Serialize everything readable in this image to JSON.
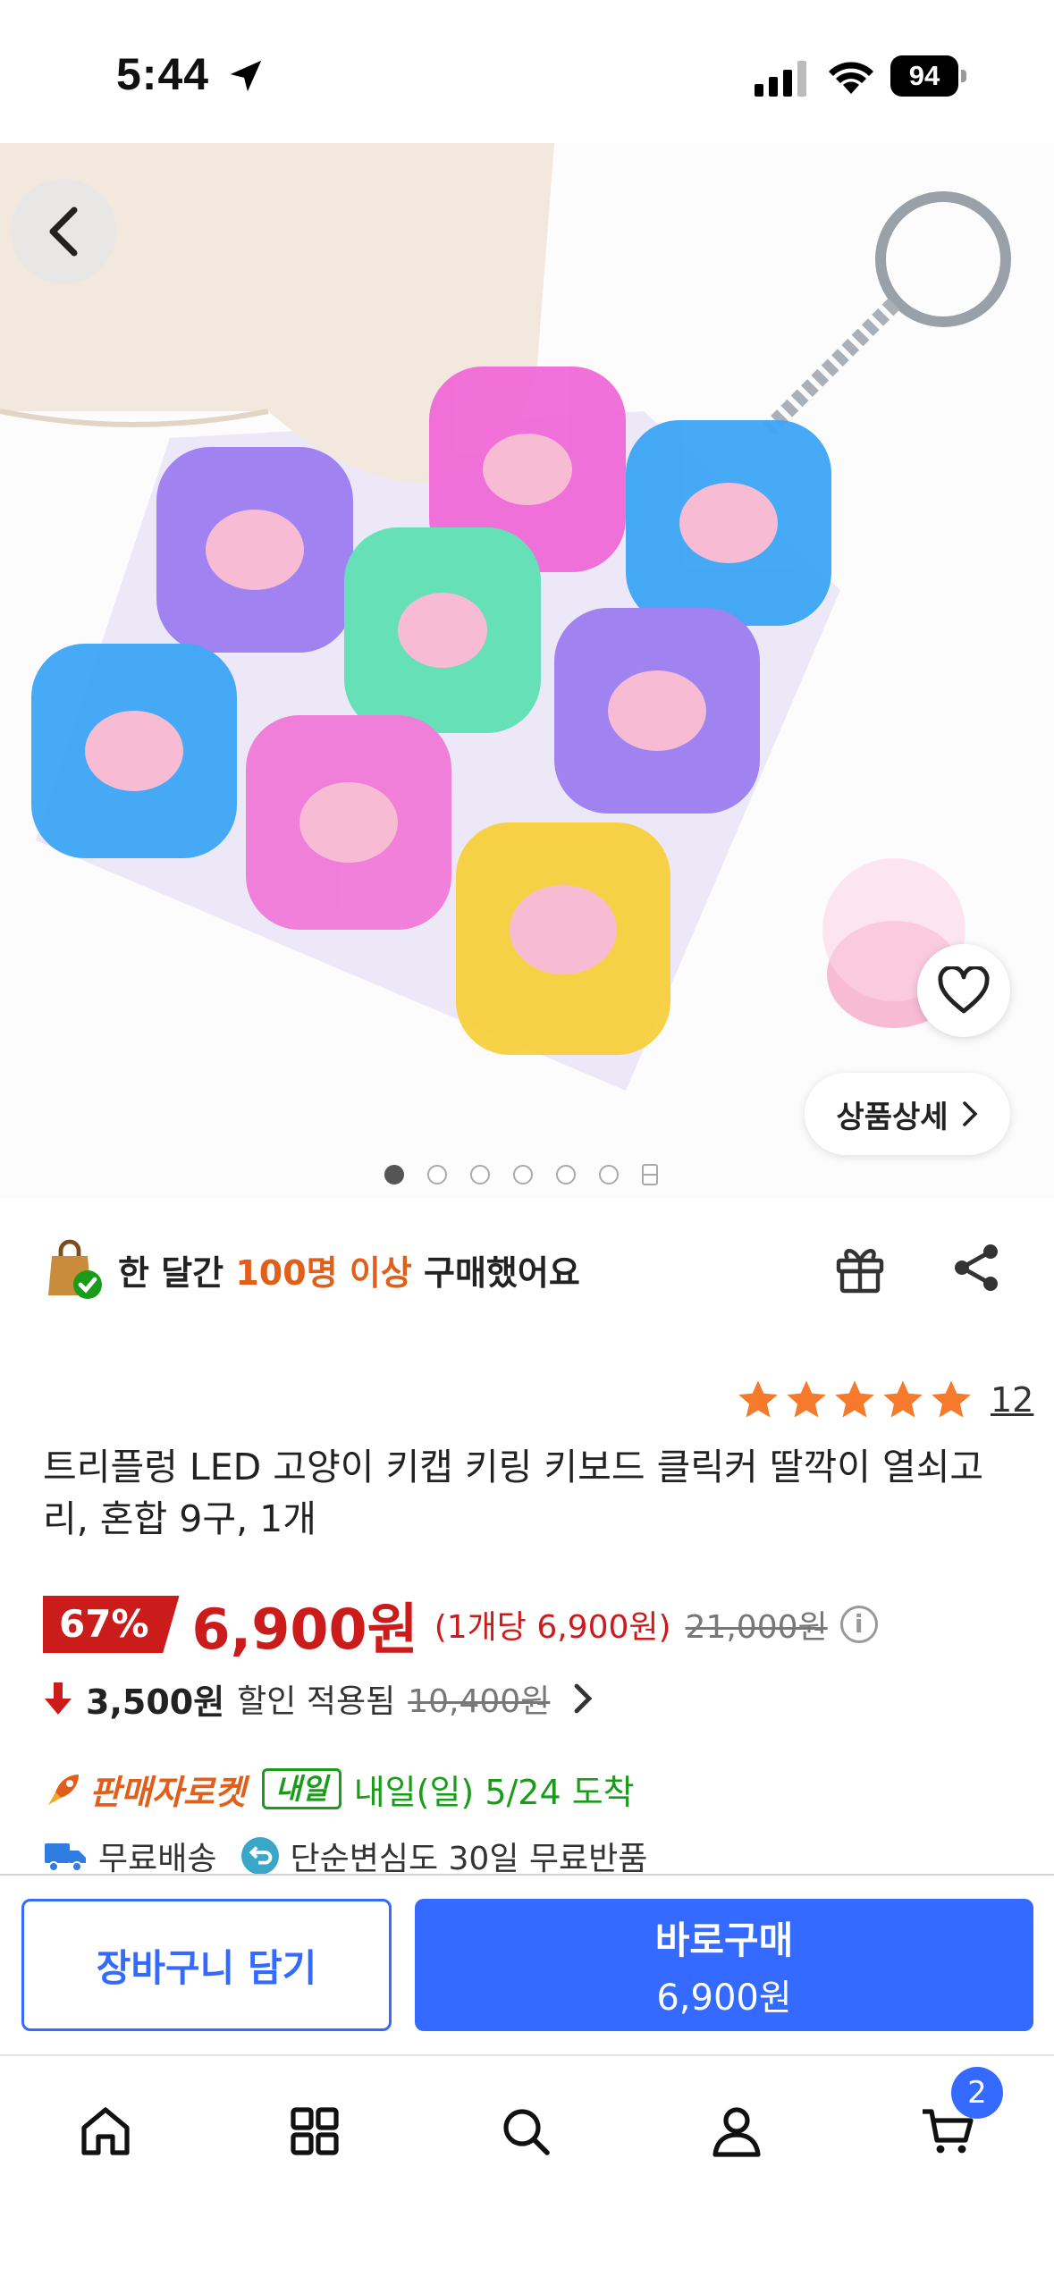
{
  "status_bar": {
    "time": "5:44",
    "battery": "94"
  },
  "hero": {
    "detail_label": "상품상세",
    "dot_count": 6
  },
  "proof": {
    "prefix": "한 달간 ",
    "highlight": "100명 이상",
    "suffix": " 구매했어요"
  },
  "rating": {
    "stars": 5,
    "review_count": "12"
  },
  "product": {
    "title": "트리플렁 LED 고양이 키캡 키링 키보드 클릭커 딸깍이 열쇠고리, 혼합 9구, 1개"
  },
  "price": {
    "discount": "67%",
    "sale": "6,900원",
    "unit": "(1개당 6,900원)",
    "original": "21,000원",
    "info_glyph": "i"
  },
  "coupon": {
    "price": "3,500원",
    "label": "할인 적용됨",
    "original": "10,400원"
  },
  "delivery": {
    "rocket_label": "판매자로켓",
    "badge": "내일",
    "arrival": "내일(일) 5/24 도착"
  },
  "shipping": {
    "free": "무료배송",
    "returns": "단순변심도 30일 무료반품"
  },
  "purchase": {
    "cart_label": "장바구니 담기",
    "buy_label": "바로구매",
    "buy_price": "6,900원"
  },
  "tabs": {
    "cart_badge": "2"
  },
  "colors": {
    "accent": "#346aff",
    "price_red": "#cc1b1b",
    "orange": "#e0601b",
    "green": "#1a9b1a",
    "star": "#f6792c"
  }
}
